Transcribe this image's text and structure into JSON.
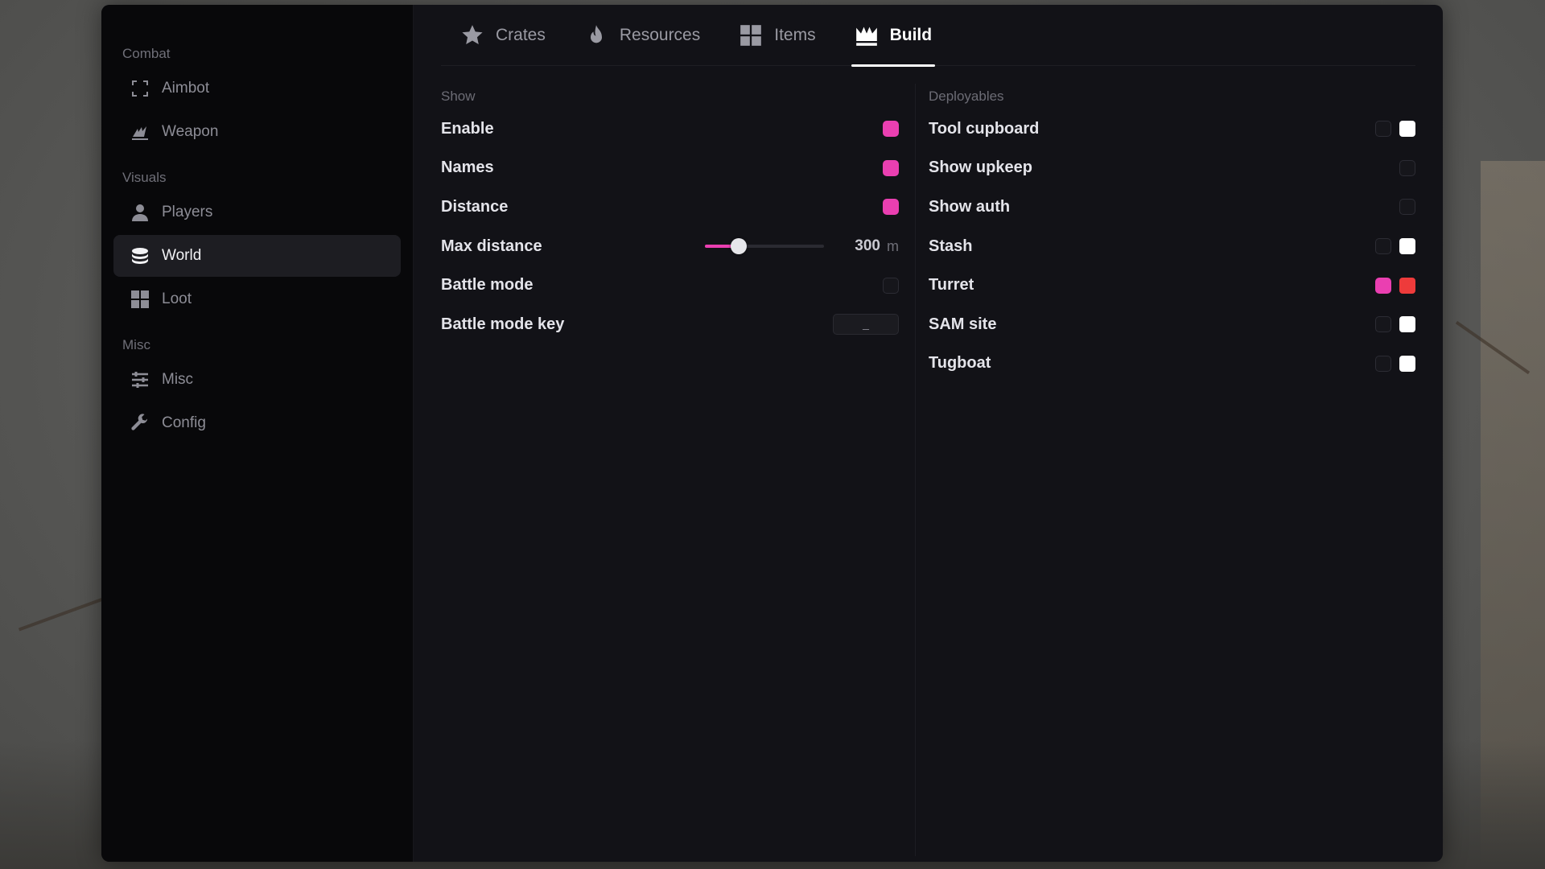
{
  "sidebar": {
    "sections": [
      {
        "label": "Combat",
        "items": [
          {
            "label": "Aimbot",
            "icon": "crosshair-frame-icon"
          },
          {
            "label": "Weapon",
            "icon": "weapon-icon"
          }
        ]
      },
      {
        "label": "Visuals",
        "items": [
          {
            "label": "Players",
            "icon": "person-icon"
          },
          {
            "label": "World",
            "icon": "globe-stack-icon",
            "active": true
          },
          {
            "label": "Loot",
            "icon": "grid-icon"
          }
        ]
      },
      {
        "label": "Misc",
        "items": [
          {
            "label": "Misc",
            "icon": "sliders-icon"
          },
          {
            "label": "Config",
            "icon": "wrench-icon"
          }
        ]
      }
    ]
  },
  "tabs": [
    {
      "label": "Crates",
      "icon": "star-icon"
    },
    {
      "label": "Resources",
      "icon": "flame-icon"
    },
    {
      "label": "Items",
      "icon": "grid-icon"
    },
    {
      "label": "Build",
      "icon": "crown-icon",
      "active": true
    }
  ],
  "show": {
    "title": "Show",
    "enable": {
      "label": "Enable",
      "checked": true
    },
    "names": {
      "label": "Names",
      "checked": true
    },
    "distance": {
      "label": "Distance",
      "checked": true
    },
    "max_distance": {
      "label": "Max distance",
      "value": "300",
      "unit": "m",
      "fraction": 0.28
    },
    "battle_mode": {
      "label": "Battle mode",
      "checked": false
    },
    "battle_mode_key": {
      "label": "Battle mode key",
      "value": "_"
    }
  },
  "deployables": {
    "title": "Deployables",
    "items": [
      {
        "label": "Tool cupboard",
        "checked": false,
        "color": "#ffffff"
      },
      {
        "label": "Show upkeep",
        "checked": false
      },
      {
        "label": "Show auth",
        "checked": false
      },
      {
        "label": "Stash",
        "checked": false,
        "color": "#ffffff"
      },
      {
        "label": "Turret",
        "checked": true,
        "color": "#ee3b3b"
      },
      {
        "label": "SAM site",
        "checked": false,
        "color": "#ffffff"
      },
      {
        "label": "Tugboat",
        "checked": false,
        "color": "#ffffff"
      }
    ]
  },
  "colors": {
    "accent": "#ea3fb1",
    "panel": "#121217",
    "sidebar": "#08080a"
  }
}
